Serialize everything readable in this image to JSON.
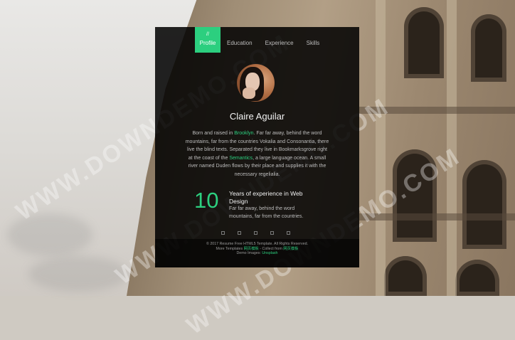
{
  "nav": {
    "tabs": [
      {
        "label": "Profile",
        "active": true
      },
      {
        "label": "Education",
        "active": false
      },
      {
        "label": "Experience",
        "active": false
      },
      {
        "label": "Skills",
        "active": false
      }
    ]
  },
  "profile": {
    "name": "Claire Aguilar",
    "bio": {
      "part1": "Born and raised in ",
      "link1": "Brooklyn",
      "part2": ". Far far away, behind the word mountains, far from the countries Vokalia and Consonantia, there live the blind texts. Separated they live in Bookmarksgrove right at the coast of the ",
      "link2": "Semantics",
      "part3": ", a large language ocean. A small river named Duden flows by their place and supplies it with the necessary regelialia."
    }
  },
  "experience": {
    "years": "10",
    "title": "Years of experience in Web Design",
    "text": "Far far away, behind the word mountains, far from the countries."
  },
  "footer": {
    "copyright": "© 2017 Resume Free HTML5 Template. All Rights Reserved.",
    "more_templates_prefix": "More Templates ",
    "more_templates_link": "网页模板",
    "collect_prefix": " - Collect from ",
    "collect_link": "网页模板",
    "demo_prefix": "Demo Images: ",
    "demo_link": "Unsplash"
  },
  "watermark": "WWW.DOWNDEMO.COM",
  "colors": {
    "accent": "#2ccf7f"
  }
}
